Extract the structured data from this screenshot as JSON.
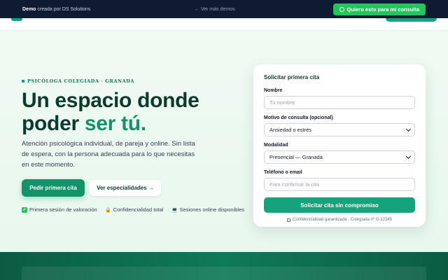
{
  "demo_bar": {
    "brand_bold": "Demo",
    "brand_rest": " creada por DS Solutions",
    "more_demos": "← Ver más demos",
    "cta_label": "Quiero esto para mi consulta"
  },
  "hero": {
    "eyebrow": "PSICÓLOGA COLEGIADA · GRANADA",
    "headline_1": "Un espacio donde",
    "headline_2": "poder ",
    "headline_accent": "ser tú.",
    "lead": "Atención psicológica individual, de pareja y online. Sin lista de espera, con la persona adecuada para lo que necesitas en este momento.",
    "primary_button": "Pedir primera cita",
    "secondary_button": "Ver especialidades →",
    "trust": [
      {
        "icon": "check-icon",
        "label": "Primera sesión de valoración"
      },
      {
        "icon": "lock-icon",
        "label": "Confidencialidad total"
      },
      {
        "icon": "laptop-icon",
        "label": "Sesiones online disponibles"
      }
    ]
  },
  "form": {
    "title": "Solicitar primera cita",
    "name_label": "Nombre",
    "name_placeholder": "Tu nombre",
    "reason_label": "Motivo de consulta (opcional)",
    "reason_value": "Ansiedad o estrés",
    "mode_label": "Modalidad",
    "mode_value": "Presencial — Granada",
    "contact_label": "Teléfono o email",
    "contact_placeholder": "Para confirmar la cita",
    "submit_label": "Solicitar cita sin compromiso",
    "footnote": "Confidencialidad garantizada · Colegiada nº G-12345"
  },
  "colors": {
    "accent": "#14936b",
    "demo_bar": "#0f1b33",
    "cta_green": "#22c55e"
  }
}
